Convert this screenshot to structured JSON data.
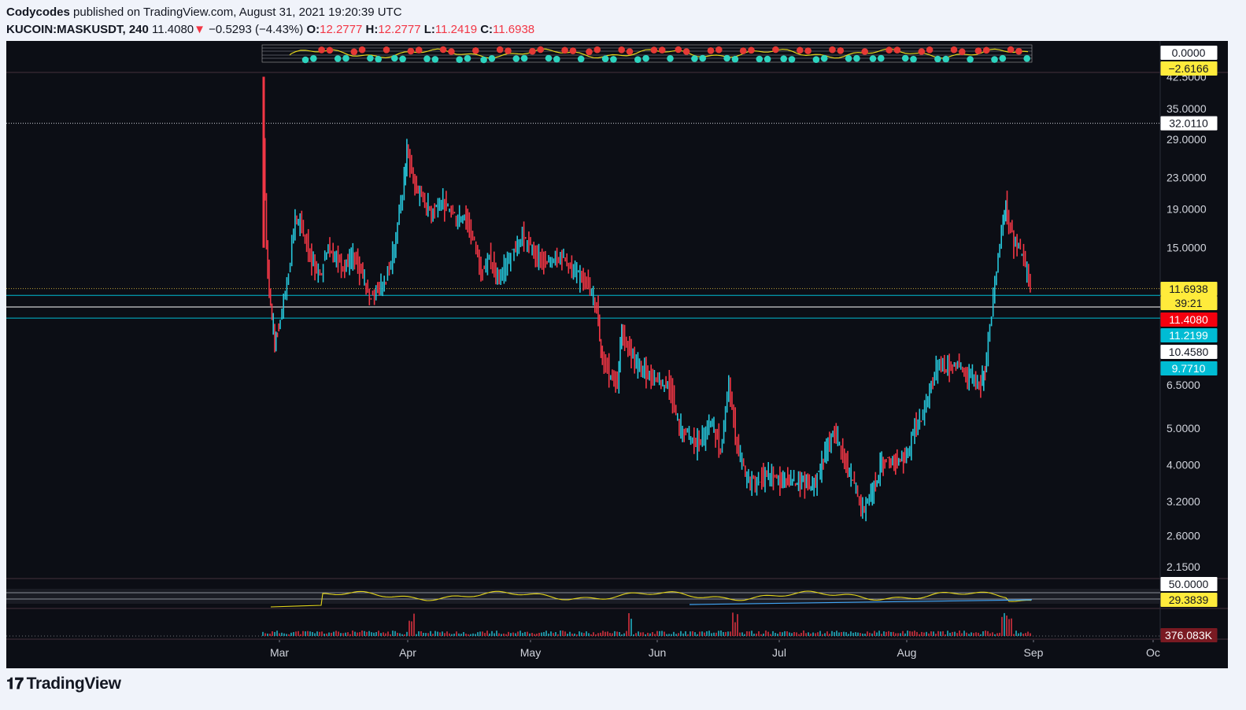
{
  "header": {
    "author": "Codycodes",
    "published_text": "published on TradingView.com, August 31, 2021 19:20:39 UTC",
    "symbol": "KUCOIN:MASKUSDT, 240",
    "last": "11.4080",
    "change": "−0.5293 (−4.43%)",
    "o_label": "O:",
    "o": "12.2777",
    "h_label": "H:",
    "h": "12.2777",
    "l_label": "L:",
    "l": "11.2419",
    "c_label": "C:",
    "c": "11.6938"
  },
  "logo": {
    "text": "TradingView",
    "icon": "tradingview-logo-icon"
  },
  "colors": {
    "background": "#0c0e15",
    "up": "#26c6da",
    "down": "#f23645",
    "oscillator": "#e3d51b",
    "label_yellow": "#ffeb3b",
    "label_red": "#f4000e",
    "label_cyan": "#00bcd4"
  },
  "chart_data": {
    "type": "line",
    "scale": "log",
    "xlabels": [
      "Mar",
      "Apr",
      "May",
      "Jun",
      "Jul",
      "Aug",
      "Sep",
      "Oc"
    ],
    "ylabels": [
      "42.5000",
      "35.0000",
      "29.0000",
      "23.0000",
      "19.0000",
      "15.0000",
      "6.5000",
      "5.0000",
      "4.0000",
      "3.2000",
      "2.6000",
      "2.1500"
    ],
    "series": [
      {
        "values": [
          [
            "2021-02-26",
            40.0
          ],
          [
            "2021-02-27",
            15.0
          ],
          [
            "2021-02-28",
            10.5
          ],
          [
            "2021-03-01",
            8.5
          ],
          [
            "2021-03-02",
            9.2
          ],
          [
            "2021-03-04",
            12.0
          ],
          [
            "2021-03-06",
            18.0
          ],
          [
            "2021-03-08",
            16.5
          ],
          [
            "2021-03-10",
            14.0
          ],
          [
            "2021-03-12",
            12.5
          ],
          [
            "2021-03-14",
            15.5
          ],
          [
            "2021-03-16",
            14.0
          ],
          [
            "2021-03-18",
            13.5
          ],
          [
            "2021-03-20",
            14.0
          ],
          [
            "2021-03-22",
            13.0
          ],
          [
            "2021-03-24",
            11.0
          ],
          [
            "2021-03-26",
            11.6
          ],
          [
            "2021-03-28",
            12.5
          ],
          [
            "2021-03-30",
            15.0
          ],
          [
            "2021-04-01",
            21.0
          ],
          [
            "2021-04-02",
            27.0
          ],
          [
            "2021-04-04",
            22.0
          ],
          [
            "2021-04-06",
            20.0
          ],
          [
            "2021-04-08",
            18.5
          ],
          [
            "2021-04-10",
            20.0
          ],
          [
            "2021-04-12",
            19.0
          ],
          [
            "2021-04-14",
            18.0
          ],
          [
            "2021-04-16",
            18.5
          ],
          [
            "2021-04-18",
            16.0
          ],
          [
            "2021-04-20",
            13.0
          ],
          [
            "2021-04-22",
            14.0
          ],
          [
            "2021-04-24",
            12.5
          ],
          [
            "2021-04-26",
            13.5
          ],
          [
            "2021-04-28",
            15.0
          ],
          [
            "2021-04-30",
            16.0
          ],
          [
            "2021-05-02",
            15.0
          ],
          [
            "2021-05-04",
            14.0
          ],
          [
            "2021-05-06",
            13.5
          ],
          [
            "2021-05-08",
            14.5
          ],
          [
            "2021-05-10",
            14.0
          ],
          [
            "2021-05-12",
            13.0
          ],
          [
            "2021-05-14",
            12.5
          ],
          [
            "2021-05-16",
            12.0
          ],
          [
            "2021-05-18",
            10.5
          ],
          [
            "2021-05-19",
            8.0
          ],
          [
            "2021-05-21",
            7.0
          ],
          [
            "2021-05-23",
            6.5
          ],
          [
            "2021-05-24",
            9.0
          ],
          [
            "2021-05-26",
            8.0
          ],
          [
            "2021-05-28",
            7.3
          ],
          [
            "2021-05-30",
            7.0
          ],
          [
            "2021-06-01",
            6.8
          ],
          [
            "2021-06-03",
            6.6
          ],
          [
            "2021-06-05",
            6.3
          ],
          [
            "2021-06-07",
            5.0
          ],
          [
            "2021-06-09",
            4.8
          ],
          [
            "2021-06-11",
            4.5
          ],
          [
            "2021-06-13",
            4.8
          ],
          [
            "2021-06-15",
            5.1
          ],
          [
            "2021-06-17",
            4.4
          ],
          [
            "2021-06-19",
            6.5
          ],
          [
            "2021-06-21",
            4.5
          ],
          [
            "2021-06-23",
            3.7
          ],
          [
            "2021-06-25",
            3.6
          ],
          [
            "2021-06-27",
            3.7
          ],
          [
            "2021-06-29",
            3.75
          ],
          [
            "2021-07-01",
            3.6
          ],
          [
            "2021-07-04",
            3.7
          ],
          [
            "2021-07-07",
            3.55
          ],
          [
            "2021-07-10",
            3.6
          ],
          [
            "2021-07-13",
            4.5
          ],
          [
            "2021-07-15",
            4.9
          ],
          [
            "2021-07-17",
            4.0
          ],
          [
            "2021-07-19",
            3.7
          ],
          [
            "2021-07-21",
            3.05
          ],
          [
            "2021-07-23",
            3.3
          ],
          [
            "2021-07-26",
            4.0
          ],
          [
            "2021-07-29",
            4.1
          ],
          [
            "2021-08-01",
            4.2
          ],
          [
            "2021-08-03",
            5.0
          ],
          [
            "2021-08-05",
            5.5
          ],
          [
            "2021-08-07",
            6.5
          ],
          [
            "2021-08-09",
            7.5
          ],
          [
            "2021-08-11",
            7.2
          ],
          [
            "2021-08-13",
            7.4
          ],
          [
            "2021-08-15",
            7.0
          ],
          [
            "2021-08-17",
            6.8
          ],
          [
            "2021-08-19",
            6.6
          ],
          [
            "2021-08-20",
            7.2
          ],
          [
            "2021-08-22",
            11.0
          ],
          [
            "2021-08-24",
            17.0
          ],
          [
            "2021-08-25",
            19.5
          ],
          [
            "2021-08-27",
            15.5
          ],
          [
            "2021-08-29",
            14.5
          ],
          [
            "2021-08-31",
            11.6938
          ]
        ]
      }
    ],
    "price_labels": [
      {
        "value": "32.0110",
        "style": "white"
      },
      {
        "value": "11.6938",
        "style": "yellow"
      },
      {
        "value": "39:21",
        "style": "yellow"
      },
      {
        "value": "11.4080",
        "style": "red"
      },
      {
        "value": "11.2199",
        "style": "cyan"
      },
      {
        "value": "10.4580",
        "style": "white"
      },
      {
        "value": "9.7710",
        "style": "cyan"
      }
    ],
    "top_pane_labels": [
      {
        "value": "0.0000",
        "style": "white"
      },
      {
        "value": "−2.6166",
        "style": "yellow"
      }
    ],
    "oscillator_pane": {
      "labels": [
        {
          "value": "50.0000",
          "style": "white"
        },
        {
          "value": "29.3839",
          "style": "yellow"
        }
      ]
    },
    "volume_pane": {
      "labels": [
        {
          "value": "376.083K",
          "style": "red"
        }
      ]
    }
  }
}
